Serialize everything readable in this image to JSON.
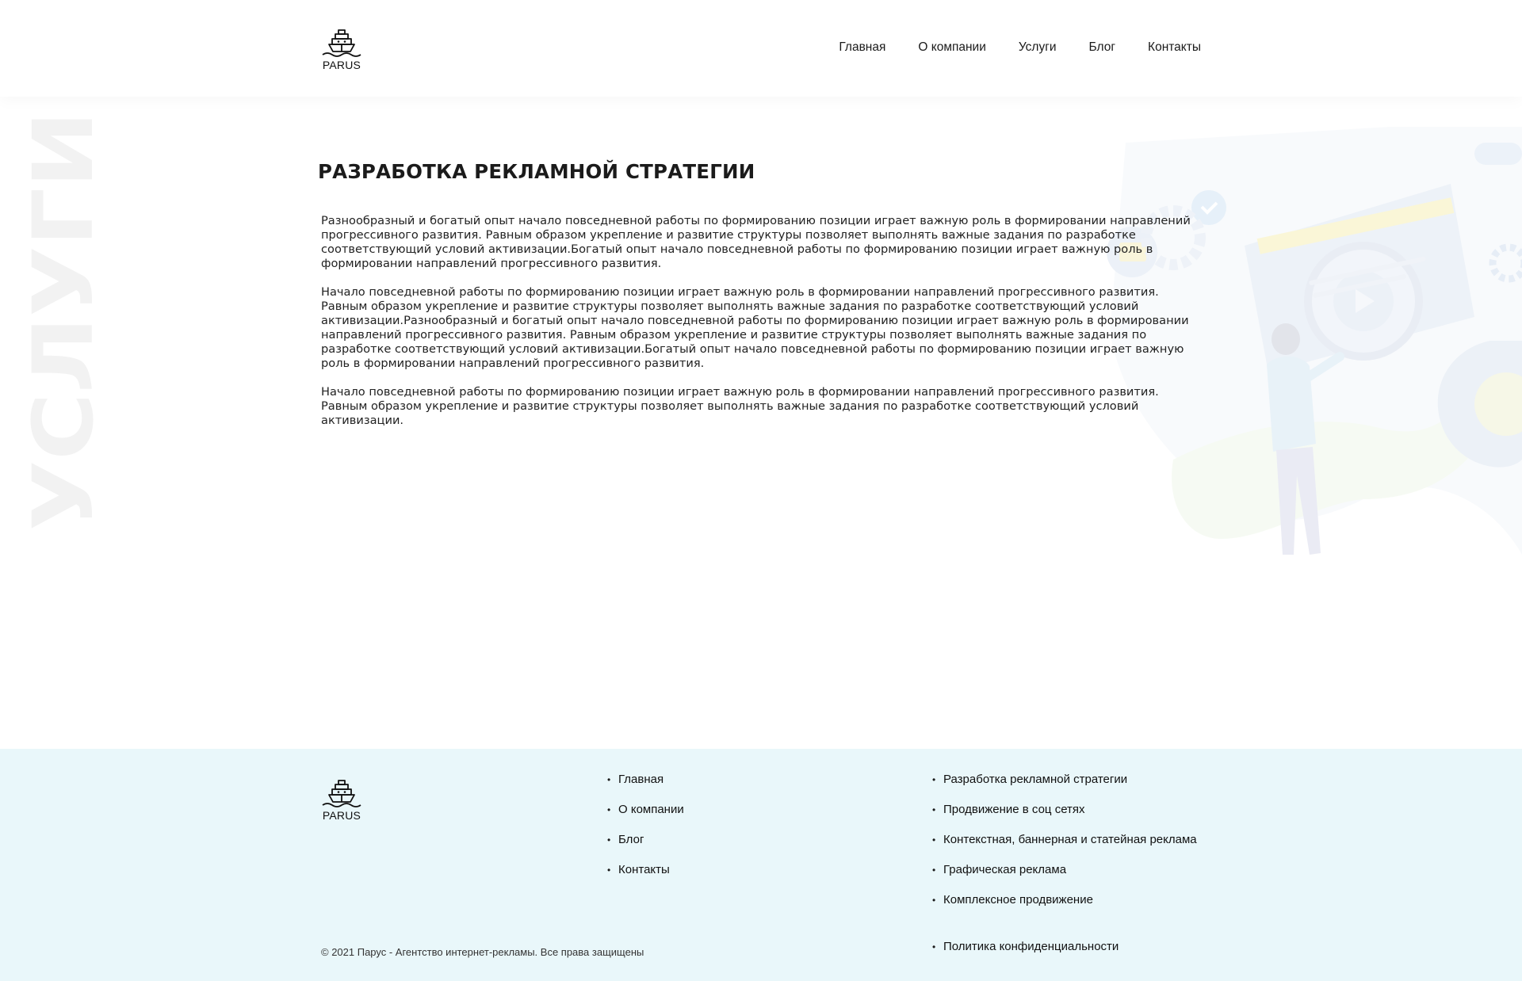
{
  "brand": {
    "logo_text": "PARUS"
  },
  "nav": {
    "items": [
      {
        "label": "Главная"
      },
      {
        "label": "О компании"
      },
      {
        "label": "Услуги"
      },
      {
        "label": "Блог"
      },
      {
        "label": "Контакты"
      }
    ]
  },
  "side_word": "УСЛУГИ",
  "main": {
    "title": "РАЗРАБОТКА РЕКЛАМНОЙ СТРАТЕГИИ",
    "paragraphs": [
      "Разнообразный и богатый опыт начало повседневной работы по формированию позиции играет важную роль в формировании направлений прогрессивного развития. Равным образом укрепление и развитие структуры позволяет выполнять важные задания по разработке соответствующий условий активизации.Богатый опыт начало повседневной работы по формированию позиции играет важную роль в формировании направлений прогрессивного развития.",
      "Начало повседневной работы по формированию позиции играет важную роль в формировании направлений прогрессивного развития. Равным образом укрепление и развитие структуры позволяет выполнять важные задания по разработке соответствующий условий активизации.Разнообразный и богатый опыт начало повседневной работы по формированию позиции играет важную роль в формировании направлений прогрессивного развития. Равным образом укрепление и развитие структуры позволяет выполнять важные задания по разработке соответствующий условий активизации.Богатый опыт начало повседневной работы по формированию позиции играет важную роль в формировании направлений прогрессивного развития.",
      "Начало повседневной работы по формированию позиции играет важную роль в формировании направлений прогрессивного развития. Равным образом укрепление и развитие структуры позволяет выполнять важные задания по разработке соответствующий условий активизации."
    ]
  },
  "footer": {
    "logo_text": "PARUS",
    "nav_items": [
      {
        "label": "Главная"
      },
      {
        "label": "О компании"
      },
      {
        "label": "Блог"
      },
      {
        "label": "Контакты"
      }
    ],
    "service_items": [
      {
        "label": "Разработка рекламной стратегии"
      },
      {
        "label": "Продвижение в соц сетях"
      },
      {
        "label": "Контекстная, баннерная и статейная реклама"
      },
      {
        "label": "Графическая реклама"
      },
      {
        "label": "Комплексное продвижение"
      }
    ],
    "policy_label": "Политика конфиденциальности",
    "copyright": "© 2021 Парус - Агентство интернет-рекламы. Все права защищены"
  },
  "colors": {
    "footer_bg": "#e9f7fa",
    "text": "#1a1a1a",
    "watermark": "#f2f2f2"
  },
  "icons": [
    "ship-logo-icon",
    "marketing-illustration"
  ]
}
